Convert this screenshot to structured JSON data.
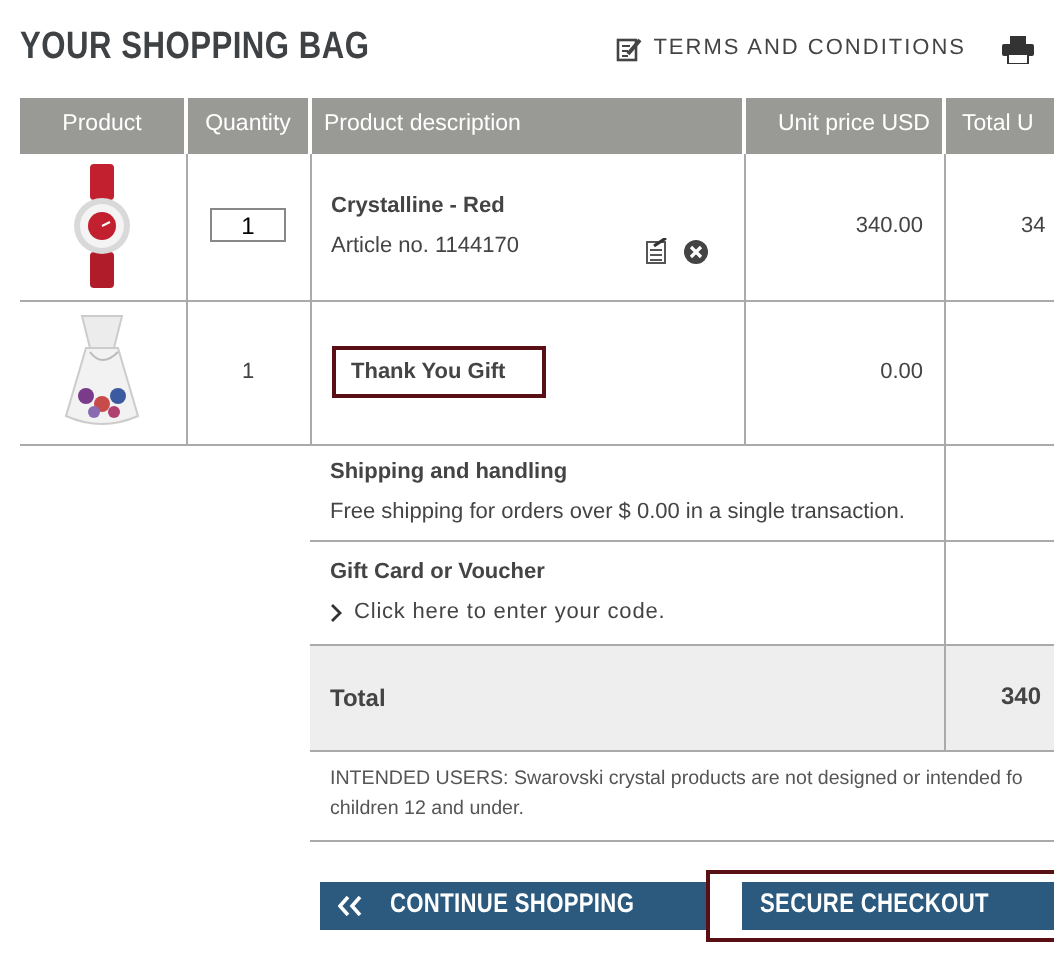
{
  "header": {
    "title": "YOUR SHOPPING BAG",
    "links": [
      {
        "kind": "terms",
        "label": "TERMS AND CONDITIONS"
      },
      {
        "kind": "print"
      }
    ]
  },
  "table": {
    "columns": [
      "Product",
      "Quantity",
      "Product description",
      "Unit price USD",
      "Total U"
    ],
    "rows": [
      {
        "kind": "product",
        "quantity": "1",
        "quantity_editable": true,
        "name": "Crystalline - Red",
        "article": "Article no. 1144170",
        "unit_price": "340.00",
        "total": "34",
        "highlighted": false
      },
      {
        "kind": "gift",
        "quantity": "1",
        "quantity_editable": false,
        "name": "Thank You Gift",
        "unit_price": "0.00",
        "highlighted": true
      }
    ]
  },
  "summary": {
    "shipping": {
      "title": "Shipping and handling",
      "note": "Free shipping for orders over $ 0.00 in a single transaction."
    },
    "voucher": {
      "title": "Gift Card or Voucher",
      "link": "Click here to enter your code."
    },
    "total": {
      "label": "Total",
      "value": "340"
    }
  },
  "notice": {
    "lines": [
      "INTENDED USERS: Swarovski crystal products are not designed or intended fo",
      "children 12 and under."
    ]
  },
  "buttons": [
    {
      "kind": "back",
      "label": "CONTINUE SHOPPING",
      "highlighted": false
    },
    {
      "kind": "checkout",
      "label": "SECURE CHECKOUT",
      "highlighted": true
    }
  ]
}
